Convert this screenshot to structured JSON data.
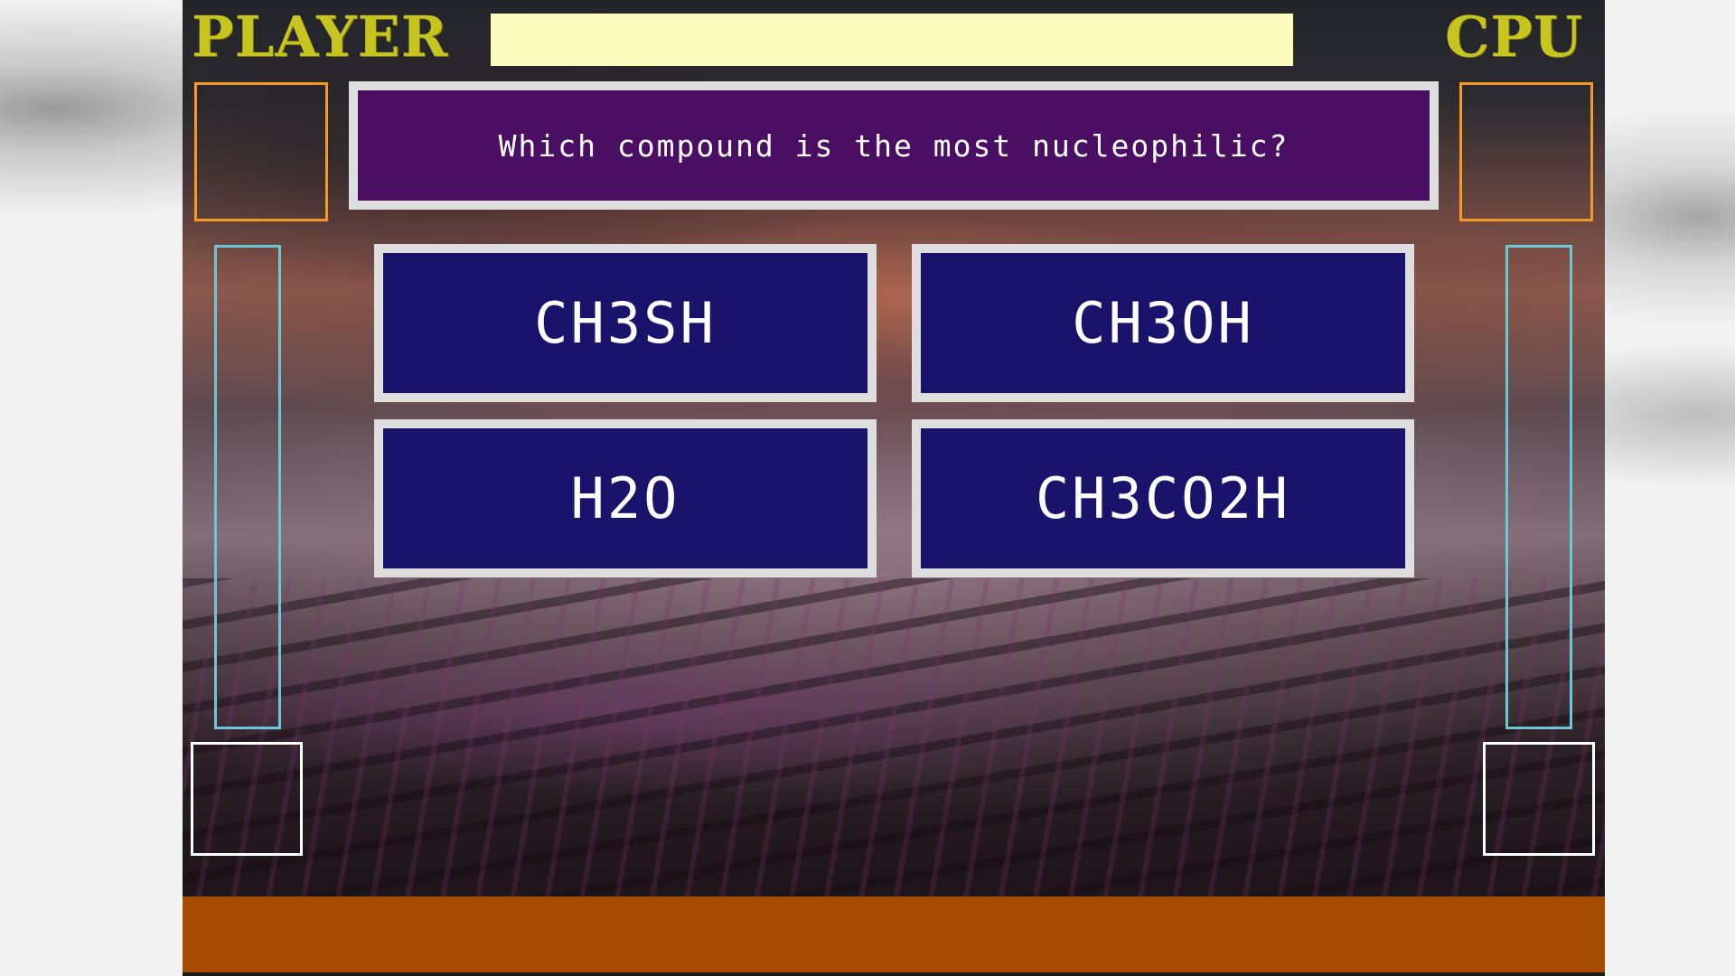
{
  "hud": {
    "player_label": "PLAYER",
    "cpu_label": "CPU"
  },
  "question": {
    "text": "Which compound is the most nucleophilic?"
  },
  "answers": [
    {
      "label": "CH3SH"
    },
    {
      "label": "CH3OH"
    },
    {
      "label": "H2O"
    },
    {
      "label": "CH3CO2H"
    }
  ],
  "colors": {
    "title_yellow": "#c7c41f",
    "timer_bar": "#fdfcbd",
    "question_bg": "#4a0f63",
    "answer_bg": "#19136b",
    "panel_border": "#dedede",
    "portrait_border": "#f39a22",
    "health_border": "#6ec5d3",
    "footer": "#a54c00"
  }
}
